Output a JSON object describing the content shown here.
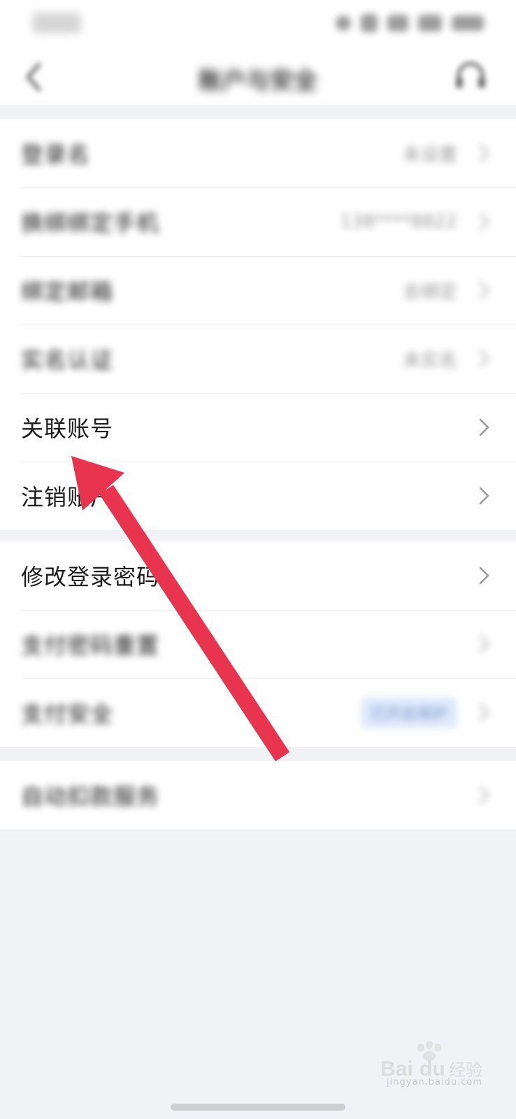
{
  "status_bar": {
    "time": "17:30"
  },
  "nav": {
    "title": "账户与安全",
    "back_icon": "chevron-left-icon",
    "support_icon": "headset-icon"
  },
  "groups": [
    {
      "items": [
        {
          "label": "登录名",
          "value": "未设置",
          "blurred": true
        },
        {
          "label": "换绑绑定手机",
          "value": "138****8822",
          "blurred": true
        },
        {
          "label": "绑定邮箱",
          "value": "去绑定",
          "blurred": true
        },
        {
          "label": "实名认证",
          "value": "未实名",
          "blurred": true
        },
        {
          "label": "关联账号",
          "value": "",
          "blurred": false
        },
        {
          "label": "注销账户",
          "value": "",
          "blurred": false
        }
      ]
    },
    {
      "items": [
        {
          "label": "修改登录密码",
          "value": "",
          "blurred": false
        },
        {
          "label": "支付密码重置",
          "value": "",
          "blurred": true
        },
        {
          "label": "支付安全",
          "value": "已开启保护",
          "blurred": true
        }
      ]
    },
    {
      "items": [
        {
          "label": "自动扣款服务",
          "value": "",
          "blurred": true
        }
      ]
    }
  ],
  "colors": {
    "background": "#f1f2f5",
    "arrow": "#e8344e",
    "text": "#1b1b1b",
    "muted": "#9a9a9a"
  },
  "watermark": {
    "brand": "Bai du 经验",
    "url": "jingyan.baidu.com"
  }
}
